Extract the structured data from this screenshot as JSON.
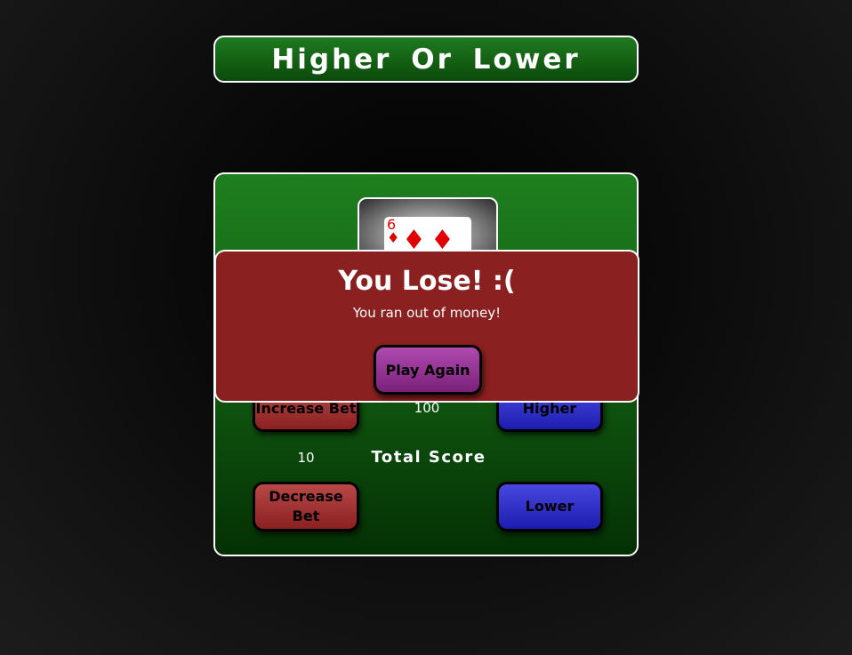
{
  "header": {
    "title": "Higher Or Lower"
  },
  "card": {
    "rank": "6",
    "suit": "diamond-icon",
    "suit_glyph": "♦",
    "color": "#e00000"
  },
  "controls": {
    "increase_bet_label": "Increase Bet",
    "decrease_bet_label": "Decrease Bet",
    "higher_label": "Higher",
    "lower_label": "Lower",
    "bet_amount": "100",
    "total_score_value": "10",
    "total_score_label": "Total Score"
  },
  "modal": {
    "title": "You Lose! :(",
    "message": "You ran out of money!",
    "play_again_label": "Play Again"
  },
  "colors": {
    "board_green": "#1f7f1f",
    "modal_red": "#8a2020",
    "button_red": "#b84848",
    "button_blue": "#4848e0",
    "button_purple": "#b04ab0"
  }
}
